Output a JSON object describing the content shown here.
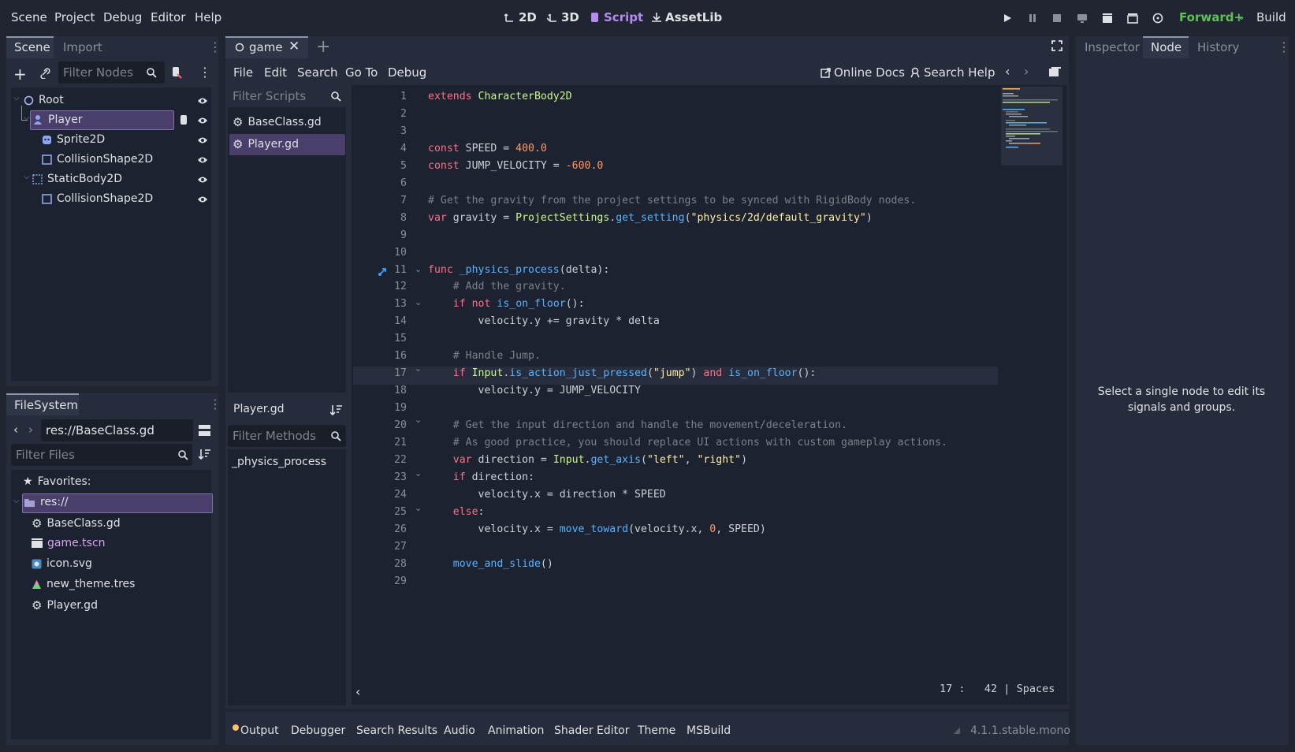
{
  "menu": [
    "Scene",
    "Project",
    "Debug",
    "Editor",
    "Help"
  ],
  "workspaces": [
    {
      "label": "2D",
      "icon": "2d-icon"
    },
    {
      "label": "3D",
      "icon": "3d-icon"
    },
    {
      "label": "Script",
      "icon": "script-icon",
      "active": true
    },
    {
      "label": "AssetLib",
      "icon": "assetlib-icon"
    }
  ],
  "renderer": "Forward+",
  "build": "Build",
  "scene_dock": {
    "tabs": [
      "Scene",
      "Import"
    ],
    "filter_placeholder": "Filter Nodes",
    "nodes": [
      {
        "label": "Root",
        "icon": "node2d-icon"
      },
      {
        "label": "Player",
        "icon": "character-icon",
        "selected": true
      },
      {
        "label": "Sprite2D",
        "icon": "sprite-icon"
      },
      {
        "label": "CollisionShape2D",
        "icon": "collision-icon"
      },
      {
        "label": "StaticBody2D",
        "icon": "staticbody-icon"
      },
      {
        "label": "CollisionShape2D",
        "icon": "collision-icon"
      }
    ]
  },
  "filesystem": {
    "title": "FileSystem",
    "path": "res://BaseClass.gd",
    "filter_placeholder": "Filter Files",
    "favorites": "Favorites:",
    "root": "res://",
    "files": [
      {
        "label": "BaseClass.gd",
        "icon": "gear-icon"
      },
      {
        "label": "game.tscn",
        "icon": "scene-icon"
      },
      {
        "label": "icon.svg",
        "icon": "image-icon"
      },
      {
        "label": "new_theme.tres",
        "icon": "theme-icon"
      },
      {
        "label": "Player.gd",
        "icon": "gear-icon"
      }
    ]
  },
  "editor_tabs": {
    "current": "game"
  },
  "script_menu": [
    "File",
    "Edit",
    "Search",
    "Go To",
    "Debug"
  ],
  "online_docs": "Online Docs",
  "search_help": "Search Help",
  "scripts": {
    "filter_placeholder": "Filter Scripts",
    "items": [
      "BaseClass.gd",
      "Player.gd"
    ],
    "current_file": "Player.gd",
    "methods_placeholder": "Filter Methods",
    "methods": [
      "_physics_process"
    ]
  },
  "code_lines": [
    "extends CharacterBody2D",
    "",
    "",
    "const SPEED = 400.0",
    "const JUMP_VELOCITY = -600.0",
    "",
    "# Get the gravity from the project settings to be synced with RigidBody nodes.",
    "var gravity = ProjectSettings.get_setting(\"physics/2d/default_gravity\")",
    "",
    "",
    "func _physics_process(delta):",
    "    # Add the gravity.",
    "    if not is_on_floor():",
    "        velocity.y += gravity * delta",
    "",
    "    # Handle Jump.",
    "    if Input.is_action_just_pressed(\"jump\") and is_on_floor():",
    "        velocity.y = JUMP_VELOCITY",
    "",
    "    # Get the input direction and handle the movement/deceleration.",
    "    # As good practice, you should replace UI actions with custom gameplay actions.",
    "    var direction = Input.get_axis(\"left\", \"right\")",
    "    if direction:",
    "        velocity.x = direction * SPEED",
    "    else:",
    "        velocity.x = move_toward(velocity.x, 0, SPEED)",
    "",
    "    move_and_slide()",
    ""
  ],
  "status": {
    "line": "17",
    "col": "42",
    "indent": "Spaces"
  },
  "right_dock": {
    "tabs": [
      "Inspector",
      "Node",
      "History"
    ],
    "message": "Select a single node to edit its signals and groups."
  },
  "bottom_tabs": [
    "Output",
    "Debugger",
    "Search Results",
    "Audio",
    "Animation",
    "Shader Editor",
    "Theme",
    "MSBuild"
  ],
  "version": "4.1.1.stable.mono",
  "colors": {
    "accent": "#b48cf0",
    "renderer": "#5fbf5a",
    "selection": "#4a3f6b"
  }
}
